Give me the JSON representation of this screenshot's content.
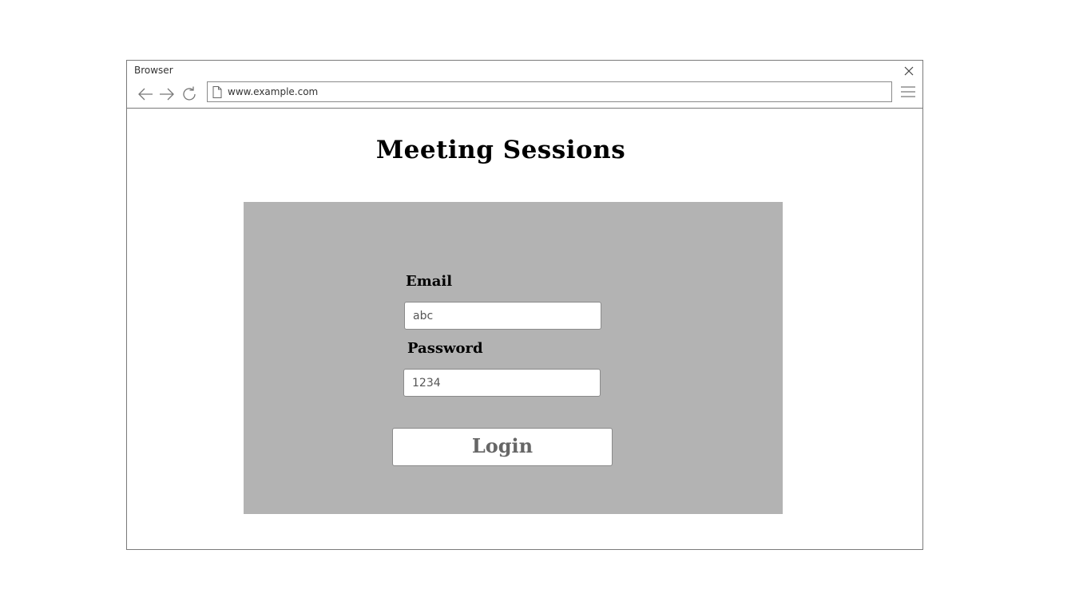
{
  "browser": {
    "title": "Browser",
    "url": "www.example.com"
  },
  "page": {
    "title": "Meeting Sessions"
  },
  "login_form": {
    "email_label": "Email",
    "email_value": "abc",
    "password_label": "Password",
    "password_value": "1234",
    "login_label": "Login"
  },
  "colors": {
    "panel_background": "#b3b3b3",
    "border": "#7a7a7a"
  },
  "icons": [
    "close-icon",
    "back-arrow-icon",
    "forward-arrow-icon",
    "refresh-icon",
    "page-icon",
    "hamburger-menu-icon"
  ]
}
